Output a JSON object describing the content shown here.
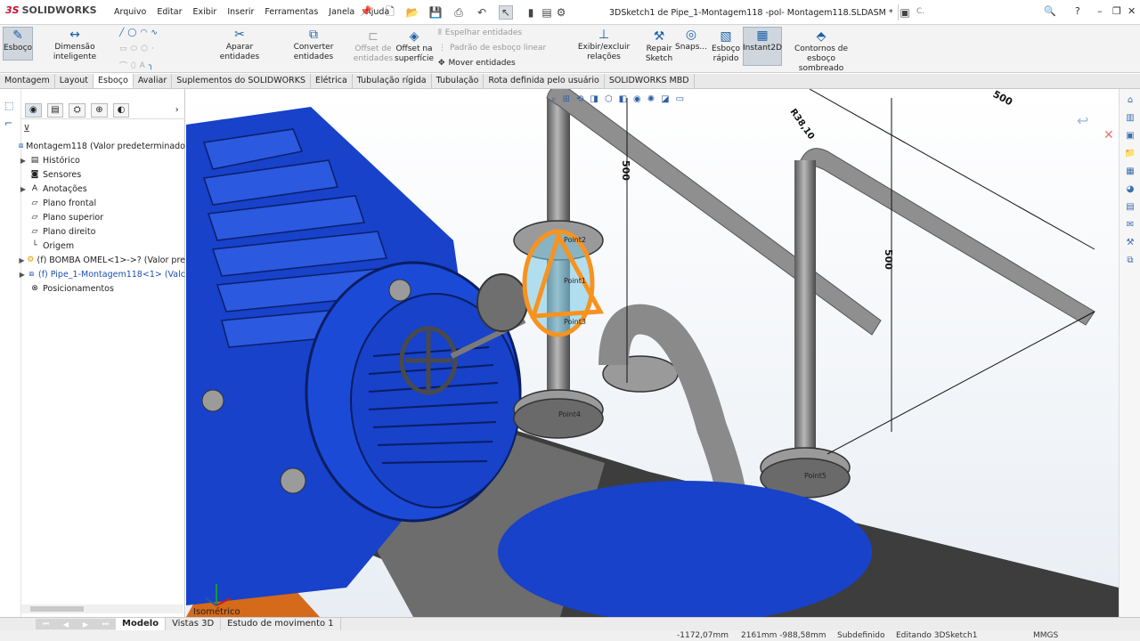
{
  "app": {
    "logo_ds": "3S",
    "logo_name": "SOLIDWORKS"
  },
  "menu": [
    "Arquivo",
    "Editar",
    "Exibir",
    "Inserir",
    "Ferramentas",
    "Janela",
    "Ajuda"
  ],
  "title": "3DSketch1 de Pipe_1-Montagem118 -pol- Montagem118.SLDASM *",
  "search": {
    "placeholder": "C."
  },
  "window_controls": {
    "help": "?",
    "minimize": "–",
    "restore": "❐",
    "close": "✕"
  },
  "ribbon": {
    "esboco": "Esboço",
    "dimensao": "Dimensão inteligente",
    "aparar": "Aparar entidades",
    "converter": "Converter entidades",
    "offset_entidades_1": "Offset de",
    "offset_entidades_2": "entidades",
    "offset_superficie_1": "Offset na",
    "offset_superficie_2": "superfície",
    "espelhar": "Espelhar entidades",
    "padrao": "Padrão de esboço linear",
    "mover": "Mover entidades",
    "exibir_relacoes": "Exibir/excluir relações",
    "repair_1": "Repair",
    "repair_2": "Sketch",
    "snaps": "Snaps...",
    "esboco_rapido_1": "Esboço",
    "esboco_rapido_2": "rápido",
    "instant2d": "Instant2D",
    "contornos_1": "Contornos de",
    "contornos_2": "esboço sombreado"
  },
  "command_tabs": [
    "Montagem",
    "Layout",
    "Esboço",
    "Avaliar",
    "Suplementos do SOLIDWORKS",
    "Elétrica",
    "Tubulação rígida",
    "Tubulação",
    "Rota definida pelo usuário",
    "SOLIDWORKS MBD"
  ],
  "selected_tab": "Esboço",
  "tree": {
    "root": "Montagem118  (Valor predeterminado",
    "items": [
      {
        "label": "Histórico",
        "expand": true
      },
      {
        "label": "Sensores",
        "expand": false
      },
      {
        "label": "Anotações",
        "expand": true
      },
      {
        "label": "Plano frontal",
        "expand": false
      },
      {
        "label": "Plano superior",
        "expand": false
      },
      {
        "label": "Plano direito",
        "expand": false
      },
      {
        "label": "Origem",
        "expand": false
      },
      {
        "label": "(f) BOMBA OMEL<1>->? (Valor pre",
        "expand": true
      },
      {
        "label": "(f) Pipe_1-Montagem118<1> (Valc",
        "expand": true
      },
      {
        "label": "Posicionamentos",
        "expand": false
      }
    ]
  },
  "viewport": {
    "dims": [
      "500",
      "500",
      "500",
      "R38,10"
    ],
    "points": [
      "Point2",
      "Point1",
      "Point3",
      "Point4",
      "Point5"
    ],
    "view_label": "Isométrico"
  },
  "bottom_tabs": [
    "Modelo",
    "Vistas 3D",
    "Estudo de movimento 1"
  ],
  "status": {
    "x": "-1172,07mm",
    "yz": "2161mm  -988,58mm",
    "state": "Subdefinido",
    "mode": "Editando 3DSketch1",
    "units": "MMGS"
  },
  "colors": {
    "accent": "#1d5fa8",
    "motor_blue": "#1742c9",
    "sketch_orange": "#f7931e",
    "pipe_gray": "#8c8c8c"
  }
}
